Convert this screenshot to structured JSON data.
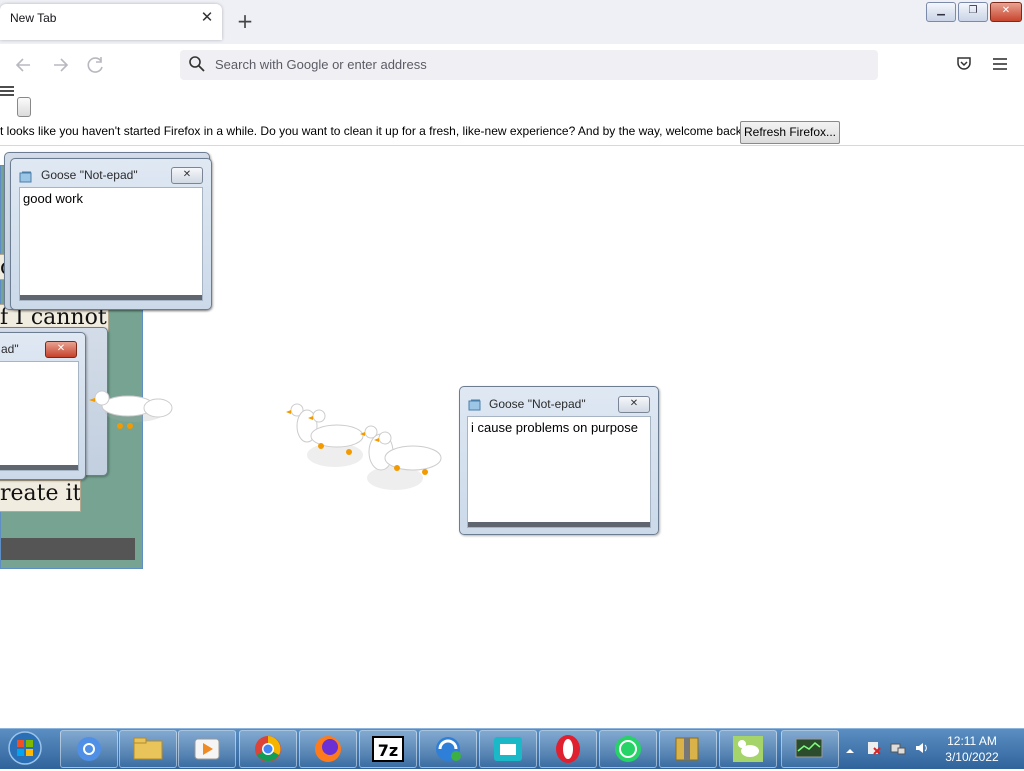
{
  "browser": {
    "tab_title": "New Tab",
    "url_placeholder": "Search with Google or enter address",
    "infobar_text": "t looks like you haven't started Firefox in a while. Do you want to clean it up for a fresh, like-new experience? And by the way, welcome back!",
    "refresh_label": "Refresh Firefox...",
    "tab_close_glyph": "✕",
    "new_tab_glyph": "+"
  },
  "window_controls": {
    "minimize": "▁",
    "restore": "❐",
    "close": "✕"
  },
  "meme": {
    "line1": "o",
    "line2": "f I cannot",
    "line3": "reate it."
  },
  "goose_windows": [
    {
      "title": "Goose \"Not-epad\"",
      "text": "good work"
    },
    {
      "title": "ad\"",
      "text": ""
    },
    {
      "title": "Goose \"Not-epad\"",
      "text": "i cause problems on purpose"
    }
  ],
  "taskbar": {
    "items": [
      "chromium",
      "file-explorer",
      "media-player",
      "chrome",
      "firefox",
      "7-zip",
      "ie-sync",
      "image-viewer",
      "opera",
      "whatsapp",
      "archive-manager",
      "goose-app",
      "network-monitor"
    ],
    "sevenzip_label": "7z",
    "clock_time": "12:11 AM",
    "clock_date": "3/10/2022"
  },
  "colors": {
    "taskbar": "#2f639b",
    "accent_blue": "#5f8ec4",
    "meme_green": "#76a392"
  }
}
